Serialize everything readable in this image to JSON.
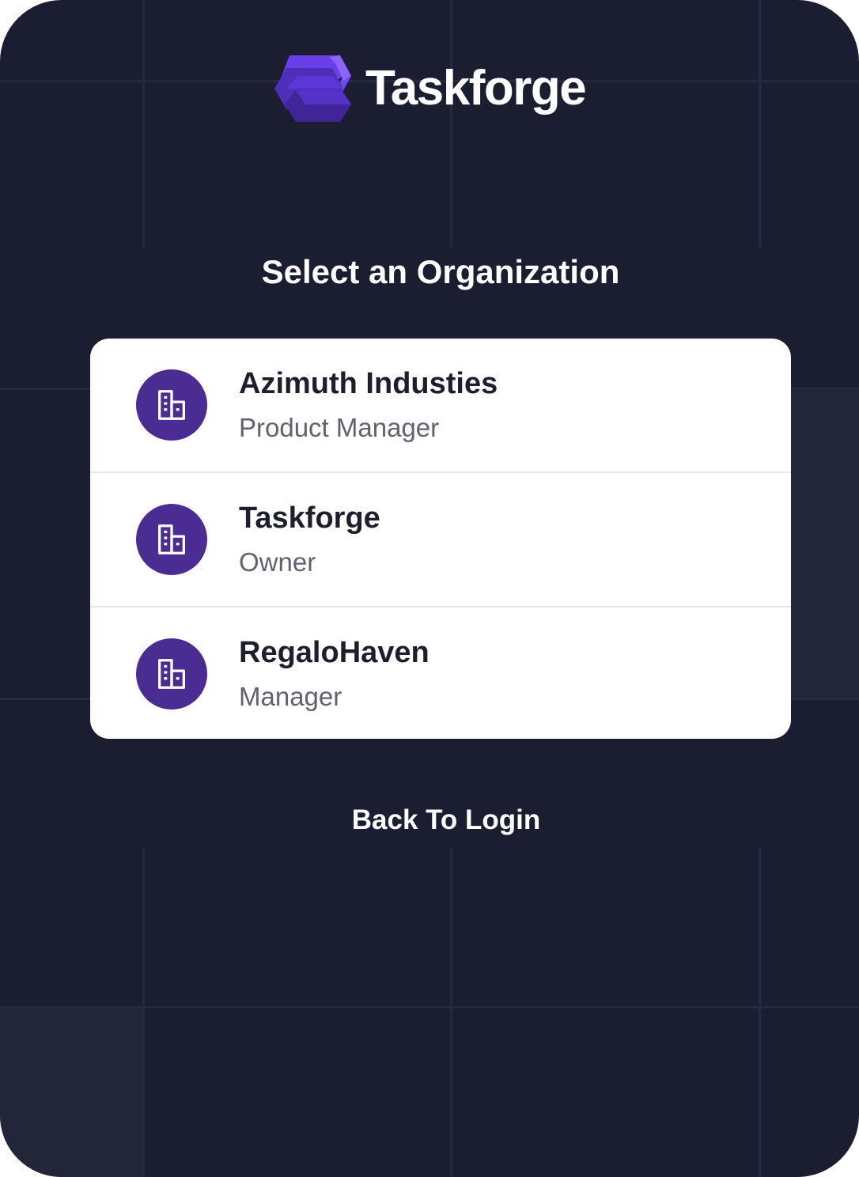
{
  "app": {
    "name": "Taskforge",
    "logo_icon": "taskforge-cube-logo-icon"
  },
  "page": {
    "title": "Select an Organization"
  },
  "organizations": [
    {
      "name": "Azimuth Industies",
      "role": "Product Manager",
      "icon": "building-icon"
    },
    {
      "name": "Taskforge",
      "role": "Owner",
      "icon": "building-icon"
    },
    {
      "name": "RegaloHaven",
      "role": "Manager",
      "icon": "building-icon"
    }
  ],
  "actions": {
    "back_label": "Back To Login"
  },
  "colors": {
    "background": "#1b1d31",
    "grid_line": "#272a3f",
    "accent": "#5b34d6",
    "avatar": "#4b2c93",
    "card": "#ffffff",
    "text_primary": "#1d1f2c",
    "text_secondary": "#5f6370"
  }
}
